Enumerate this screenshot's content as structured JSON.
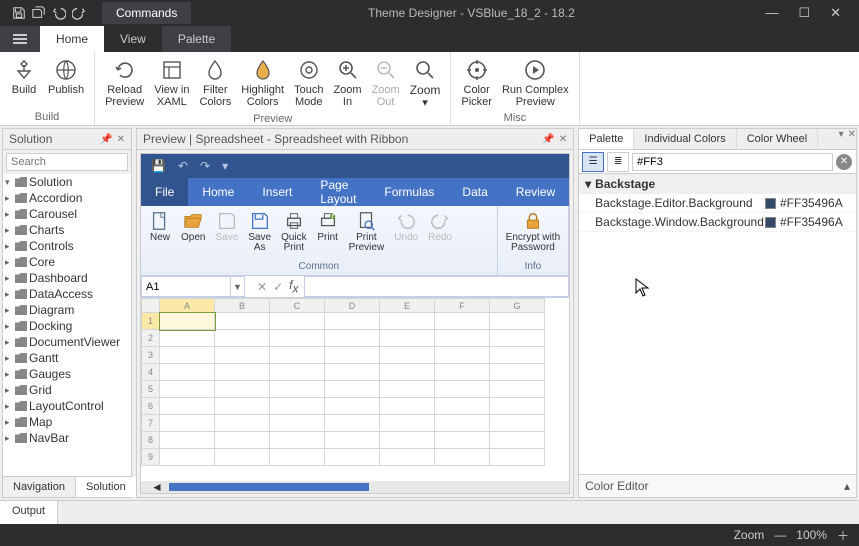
{
  "title": "Theme Designer  - VSBlue_18_2 - 18.2",
  "commands_tab": "Commands",
  "menu": {
    "home": "Home",
    "view": "View",
    "palette": "Palette"
  },
  "ribbon": {
    "build_group": "Build",
    "build": "Build",
    "publish": "Publish",
    "preview_group": "Preview",
    "reload": "Reload\nPreview",
    "xaml": "View in\nXAML",
    "filter": "Filter\nColors",
    "highlight": "Highlight\nColors",
    "touch": "Touch\nMode",
    "zoomin": "Zoom\nIn",
    "zoomout": "Zoom\nOut",
    "zoom": "Zoom",
    "misc_group": "Misc",
    "picker": "Color\nPicker",
    "complex": "Run Complex\nPreview"
  },
  "solution": {
    "title": "Solution",
    "search": "Search",
    "root": "Solution",
    "items": [
      "Accordion",
      "Carousel",
      "Charts",
      "Controls",
      "Core",
      "Dashboard",
      "DataAccess",
      "Diagram",
      "Docking",
      "DocumentViewer",
      "Gantt",
      "Gauges",
      "Grid",
      "LayoutControl",
      "Map",
      "NavBar"
    ],
    "tabs": {
      "nav": "Navigation",
      "sol": "Solution"
    }
  },
  "preview": {
    "title": "Preview | Spreadsheet - Spreadsheet with Ribbon"
  },
  "ss": {
    "tabs": {
      "file": "File",
      "home": "Home",
      "insert": "Insert",
      "pagelayout": "Page Layout",
      "formulas": "Formulas",
      "data": "Data",
      "review": "Review"
    },
    "btns": {
      "new": "New",
      "open": "Open",
      "save": "Save",
      "saveas": "Save\nAs",
      "quickprint": "Quick\nPrint",
      "print": "Print",
      "printpreview": "Print\nPreview",
      "undo": "Undo",
      "redo": "Redo",
      "encrypt": "Encrypt with\nPassword"
    },
    "groups": {
      "common": "Common",
      "info": "Info"
    },
    "cellref": "A1",
    "cols": [
      "A",
      "B",
      "C",
      "D",
      "E",
      "F",
      "G"
    ],
    "rows": [
      "1",
      "2",
      "3",
      "4",
      "5",
      "6",
      "7",
      "8",
      "9"
    ]
  },
  "palette": {
    "tabs": {
      "pal": "Palette",
      "ind": "Individual Colors",
      "wheel": "Color Wheel"
    },
    "search": "#FF3",
    "group": "Backstage",
    "rows": [
      {
        "name": "Backstage.Editor.Background",
        "value": "#FF35496A"
      },
      {
        "name": "Backstage.Window.Background",
        "value": "#FF35496A"
      }
    ],
    "coloreditor": "Color Editor"
  },
  "output": "Output",
  "status": {
    "zoom": "Zoom",
    "pct": "100%"
  }
}
